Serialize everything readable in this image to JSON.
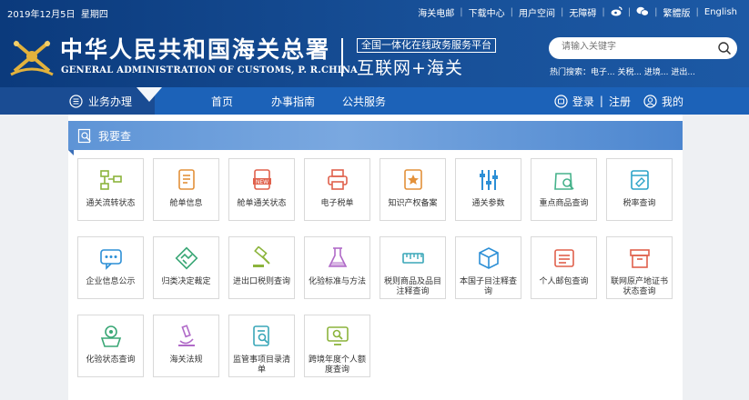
{
  "header": {
    "date": "2019年12月5日",
    "weekday": "星期四",
    "links": [
      "海关电邮",
      "下载中心",
      "用户空间",
      "无障碍"
    ],
    "lang_traditional": "繁體版",
    "lang_english": "English",
    "org_name_cn": "中华人民共和国海关总署",
    "org_name_en": "GENERAL ADMINISTRATION OF CUSTOMS, P. R.CHINA",
    "platform_label": "全国一体化在线政务服务平台",
    "slogan": "互联网+海关",
    "search_placeholder": "请输入关键字",
    "hot_label": "热门搜索：",
    "hot_terms": "电子... 关税... 进境... 进出..."
  },
  "nav": {
    "business": "业务办理",
    "home": "首页",
    "guide": "办事指南",
    "public": "公共服务",
    "login": "登录",
    "separator": "|",
    "register": "注册",
    "mine": "我的"
  },
  "section": {
    "title": "我要查"
  },
  "tiles": [
    {
      "label": "通关流转状态",
      "icon": "workflow-icon",
      "color": "#8cb43c"
    },
    {
      "label": "舱单信息",
      "icon": "document-icon",
      "color": "#e3913a"
    },
    {
      "label": "舱单通关状态",
      "icon": "new-document-icon",
      "color": "#e0614c"
    },
    {
      "label": "电子税单",
      "icon": "printer-icon",
      "color": "#e0614c"
    },
    {
      "label": "知识产权备案",
      "icon": "star-certificate-icon",
      "color": "#e3913a"
    },
    {
      "label": "通关参数",
      "icon": "sliders-icon",
      "color": "#2c8fd6"
    },
    {
      "label": "重点商品查询",
      "icon": "bag-search-icon",
      "color": "#46b28b"
    },
    {
      "label": "税率查询",
      "icon": "tag-card-icon",
      "color": "#2ca3c8"
    },
    {
      "label": "企业信息公示",
      "icon": "chat-bubble-icon",
      "color": "#2c8fd6"
    },
    {
      "label": "归类决定裁定",
      "icon": "handshake-icon",
      "color": "#3aa776"
    },
    {
      "label": "进出口税则查询",
      "icon": "gavel-icon",
      "color": "#8cb43c"
    },
    {
      "label": "化验标准与方法",
      "icon": "flask-icon",
      "color": "#b06ac8"
    },
    {
      "label": "税则商品及品目注释查询",
      "icon": "ruler-icon",
      "color": "#3aa7b8"
    },
    {
      "label": "本国子目注释查询",
      "icon": "box-icon",
      "color": "#2c8fd6"
    },
    {
      "label": "个人邮包查询",
      "icon": "mail-list-icon",
      "color": "#e0614c"
    },
    {
      "label": "联网原产地证书状态查询",
      "icon": "archive-box-icon",
      "color": "#e0614c"
    },
    {
      "label": "化验状态查询",
      "icon": "lab-basket-icon",
      "color": "#3aa776"
    },
    {
      "label": "海关法规",
      "icon": "microscope-icon",
      "color": "#b06ac8"
    },
    {
      "label": "监管事项目录清单",
      "icon": "checklist-search-icon",
      "color": "#3aa7b8"
    },
    {
      "label": "跨境年度个人额度查询",
      "icon": "monitor-search-icon",
      "color": "#8cb43c"
    }
  ]
}
